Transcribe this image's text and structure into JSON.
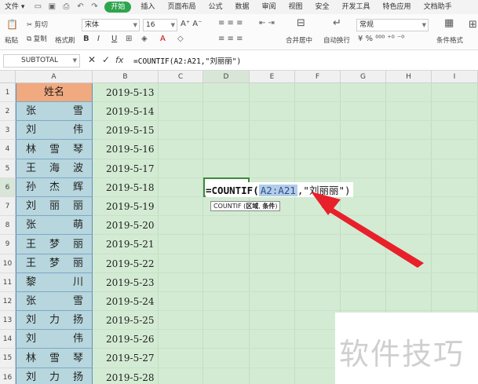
{
  "ribbon": {
    "tabs": [
      "文件",
      "开始",
      "插入",
      "页面布局",
      "公式",
      "数据",
      "审阅",
      "视图",
      "安全",
      "开发工具",
      "特色应用",
      "文档助手"
    ],
    "active_tab": "开始",
    "clipboard": {
      "cut": "剪切",
      "copy": "复制",
      "paste": "粘贴",
      "format_painter": "格式刷"
    },
    "font_name": "宋体",
    "font_size": "16",
    "font_buttons": [
      "B",
      "I",
      "U",
      "A"
    ],
    "merge_center": "合并居中",
    "wrap_text": "自动换行",
    "number_format": "常规",
    "conditional_format": "条件格式"
  },
  "formula_bar": {
    "name_box": "SUBTOTAL",
    "cancel_icon": "✕",
    "confirm_icon": "✓",
    "fx_label": "fx",
    "formula": "=COUNTIF(A2:A21,\"刘丽丽\")"
  },
  "sheet": {
    "columns": [
      "A",
      "B",
      "C",
      "D",
      "E",
      "F",
      "G",
      "H",
      "I"
    ],
    "selected_column": "D",
    "rows": [
      "1",
      "2",
      "3",
      "4",
      "5",
      "6",
      "7",
      "8",
      "9",
      "10",
      "11",
      "12",
      "13",
      "14",
      "15",
      "16"
    ],
    "selected_row": "6",
    "header_name": "姓名",
    "names": [
      [
        "张",
        "雪"
      ],
      [
        "刘",
        "伟"
      ],
      [
        "林",
        "雪",
        "琴"
      ],
      [
        "王",
        "海",
        "波"
      ],
      [
        "孙",
        "杰",
        "辉"
      ],
      [
        "刘",
        "丽",
        "丽"
      ],
      [
        "张",
        "萌"
      ],
      [
        "王",
        "梦",
        "丽"
      ],
      [
        "王",
        "梦",
        "丽"
      ],
      [
        "黎",
        "川"
      ],
      [
        "张",
        "雪"
      ],
      [
        "刘",
        "力",
        "扬"
      ],
      [
        "刘",
        "伟"
      ],
      [
        "林",
        "雪",
        "琴"
      ],
      [
        "刘",
        "力",
        "扬"
      ]
    ],
    "dates": [
      "2019-5-13",
      "2019-5-14",
      "2019-5-15",
      "2019-5-16",
      "2019-5-17",
      "2019-5-18",
      "2019-5-19",
      "2019-5-20",
      "2019-5-21",
      "2019-5-22",
      "2019-5-23",
      "2019-5-24",
      "2019-5-25",
      "2019-5-26",
      "2019-5-27",
      "2019-5-28"
    ],
    "editing_cell": {
      "prefix": "=COUNTIF(",
      "range": "A2:A21",
      "rest": ",\"刘丽丽\")",
      "tooltip_func": "COUNTIF (",
      "tooltip_arg1": "区域",
      "tooltip_sep": ", ",
      "tooltip_arg2": "条件",
      "tooltip_end": ")"
    }
  },
  "watermark": "软件技巧",
  "colors": {
    "accent": "#2ea44f",
    "sheet_bg": "#d3ebd3",
    "name_col": "#b7d6dd",
    "header_cell": "#f1a97f",
    "arrow": "#e8202a"
  }
}
